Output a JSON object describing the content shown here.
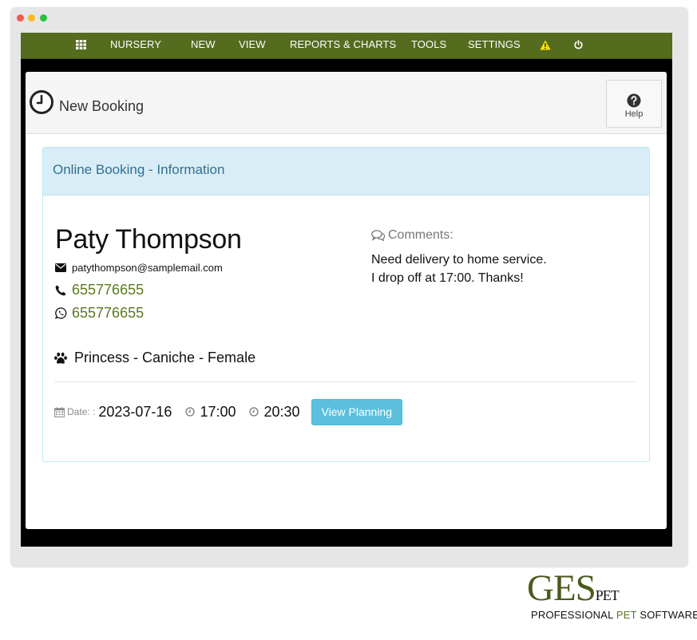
{
  "nav": {
    "items": [
      {
        "label": "NURSERY"
      },
      {
        "label": "NEW"
      },
      {
        "label": "VIEW"
      },
      {
        "label": "REPORTS & CHARTS"
      },
      {
        "label": "TOOLS"
      },
      {
        "label": "SETTINGS"
      }
    ],
    "icons": [
      "grid-icon",
      "warning-icon",
      "power-icon"
    ],
    "warning_color": "#f5e400",
    "bar_color": "#556b1e"
  },
  "page": {
    "title": "New Booking",
    "help_label": "Help"
  },
  "card": {
    "title": "Online Booking - Information",
    "client_name": "Paty Thompson",
    "email": "patythompson@samplemail.com",
    "phone": "655776655",
    "whatsapp": "655776655",
    "pet": "Princess - Caniche - Female",
    "comments_label": "Comments:",
    "comments_lines": [
      "Need delivery to home service.",
      "I drop off at 17:00. Thanks!"
    ],
    "date_label": "Date: :",
    "date": "2023-07-16",
    "time_start": "17:00",
    "time_end": "20:30",
    "view_planning_label": "View Planning",
    "accent_link_color": "#5a7a1f",
    "header_color": "#d9edf7"
  },
  "brand": {
    "logo_part1": "GES",
    "logo_part2": "PET",
    "tagline_part1": "PROFESSIONAL ",
    "tagline_part2": "PET",
    "tagline_part3": " SOFTWARE"
  }
}
